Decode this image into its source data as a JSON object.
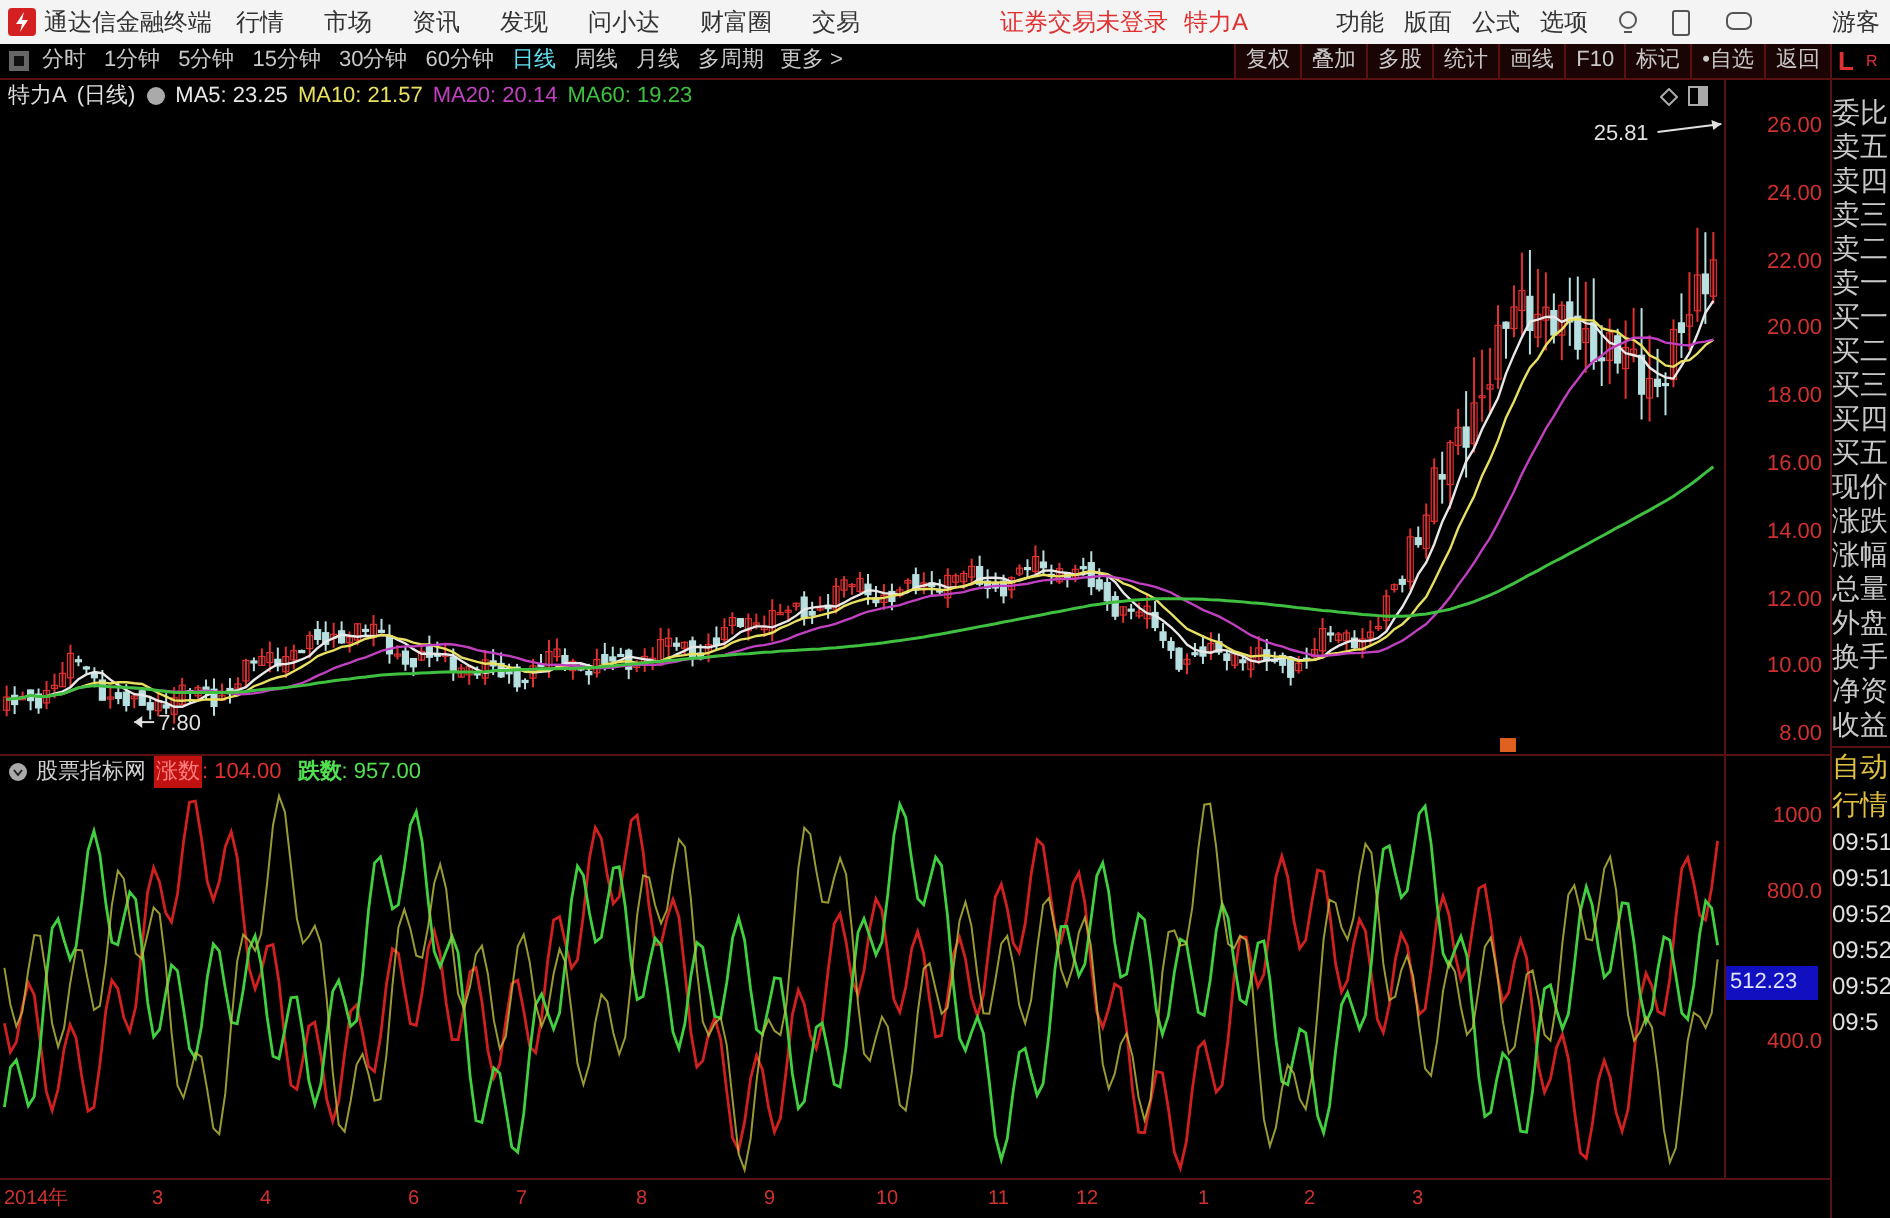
{
  "title_bar": {
    "app_name": "通达信金融终端",
    "menu": [
      "行情",
      "市场",
      "资讯",
      "发现",
      "问小达",
      "财富圈",
      "交易"
    ],
    "login_status": "证券交易未登录",
    "stock_name": "特力A",
    "tools": [
      "功能",
      "版面",
      "公式",
      "选项"
    ],
    "user": "游客"
  },
  "toolbar": {
    "periods": [
      {
        "label": "分时",
        "selected": false
      },
      {
        "label": "1分钟",
        "selected": false
      },
      {
        "label": "5分钟",
        "selected": false
      },
      {
        "label": "15分钟",
        "selected": false
      },
      {
        "label": "30分钟",
        "selected": false
      },
      {
        "label": "60分钟",
        "selected": false
      },
      {
        "label": "日线",
        "selected": true
      },
      {
        "label": "周线",
        "selected": false
      },
      {
        "label": "月线",
        "selected": false
      },
      {
        "label": "多周期",
        "selected": false
      }
    ],
    "more": "更多 >",
    "actions": [
      "复权",
      "叠加",
      "多股",
      "统计",
      "画线",
      "F10",
      "标记",
      "•自选",
      "返回"
    ],
    "corner_left": "L",
    "corner_right": "R"
  },
  "main_chart": {
    "title": "特力A",
    "period": "(日线)",
    "indicators": [
      {
        "label": "MA5: 23.25",
        "color": "#e8e8e8"
      },
      {
        "label": "MA10: 21.57",
        "color": "#e8e060"
      },
      {
        "label": "MA20: 20.14",
        "color": "#c040c0"
      },
      {
        "label": "MA60: 19.23",
        "color": "#40c040"
      }
    ],
    "price_axis": [
      "26.00",
      "24.00",
      "22.00",
      "20.00",
      "18.00",
      "16.00",
      "14.00",
      "12.00",
      "10.00",
      "8.00"
    ],
    "high_label": "25.81",
    "low_label": "7.80"
  },
  "sub_chart": {
    "title": "股票指标网",
    "rise_label": "涨数",
    "rise_value": ": 104.00",
    "fall_label": "跌数",
    "fall_value": ": 957.00",
    "axis": [
      "1000",
      "800.0",
      "400.0"
    ],
    "current_value": "512.23"
  },
  "quote_fields": [
    "委比",
    "卖五",
    "卖四",
    "卖三",
    "卖二",
    "卖一",
    "买一",
    "买二",
    "买三",
    "买四",
    "买五",
    "现价",
    "涨跌",
    "涨幅",
    "总量",
    "外盘",
    "换手",
    "净资",
    "收益"
  ],
  "side_tabs": [
    "自动",
    "行情"
  ],
  "times": [
    "09:51",
    "09:51",
    "09:52",
    "09:52",
    "09:52",
    "09:5"
  ],
  "x_axis": [
    "2014年",
    "3",
    "4",
    "6",
    "7",
    "8",
    "9",
    "10",
    "11",
    "12",
    "1",
    "2",
    "3"
  ]
}
